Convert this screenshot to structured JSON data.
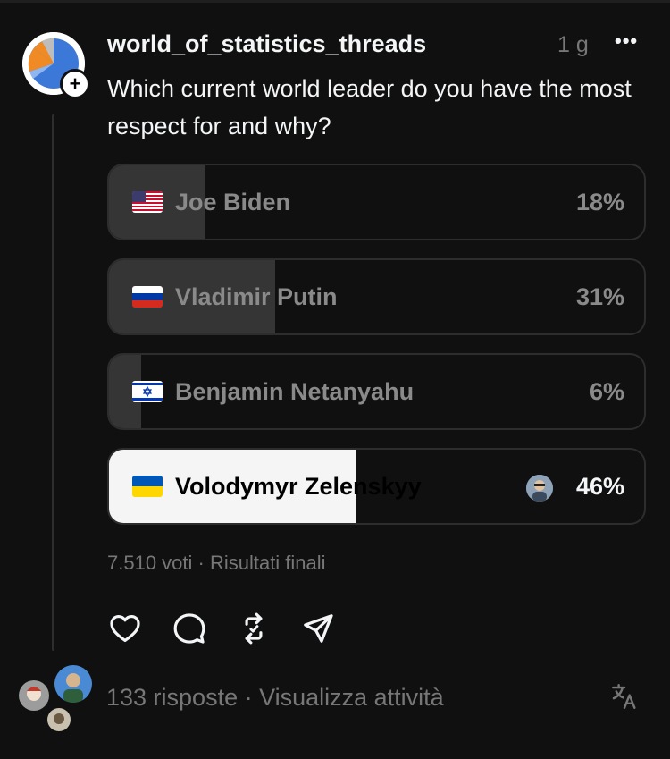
{
  "post": {
    "username": "world_of_statistics_threads",
    "time": "1 g",
    "more_icon": "more-horizontal-icon",
    "question": "Which current world leader do you have the most respect for and why?"
  },
  "poll": {
    "options": [
      {
        "flag": "us-flag-icon",
        "label": "Joe Biden",
        "percent_text": "18%",
        "percent": 18
      },
      {
        "flag": "ru-flag-icon",
        "label": "Vladimir Putin",
        "percent_text": "31%",
        "percent": 31
      },
      {
        "flag": "il-flag-icon",
        "label": "Benjamin Netanyahu",
        "percent_text": "6%",
        "percent": 6
      },
      {
        "flag": "ua-flag-icon",
        "label": "Volodymyr Zelenskyy",
        "percent_text": "46%",
        "percent": 46,
        "winner": true
      }
    ],
    "meta": "7.510 voti · Risultati finali"
  },
  "actions": {
    "like_icon": "heart-icon",
    "comment_icon": "comment-icon",
    "repost_icon": "repost-icon",
    "share_icon": "send-icon"
  },
  "footer": {
    "replies": "133 risposte · Visualizza attività",
    "translate_icon": "translate-icon"
  },
  "colors": {
    "background": "#101010",
    "text": "#f3f5f7",
    "muted": "#777777",
    "fill": "#353535",
    "winner_fill": "#f5f5f5"
  }
}
